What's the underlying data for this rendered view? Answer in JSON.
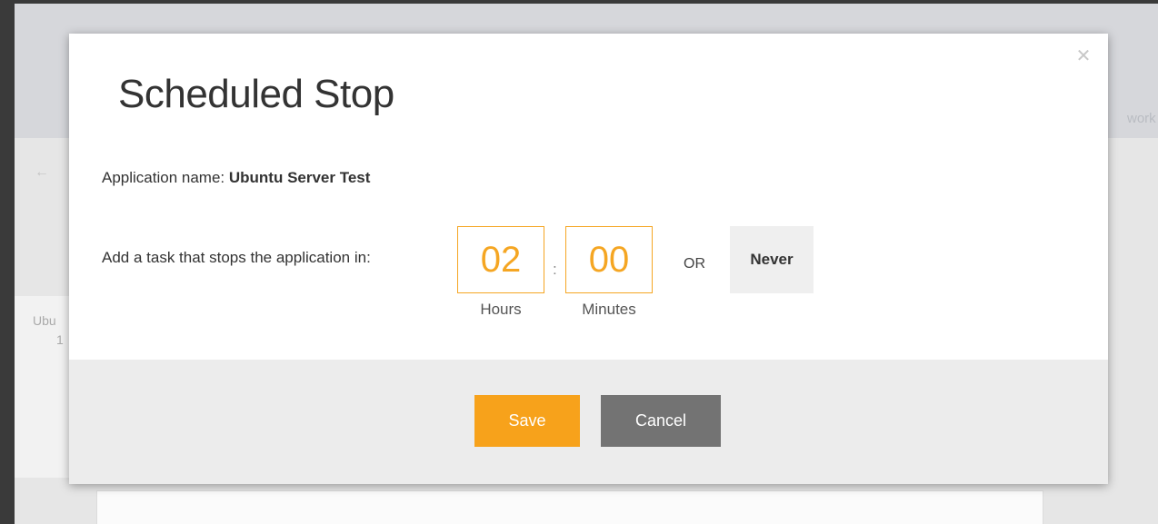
{
  "background": {
    "side_text": "work",
    "arrow": "←",
    "card_name": "Ubu",
    "card_num": "1"
  },
  "modal": {
    "title": "Scheduled Stop",
    "close_icon": "✕",
    "app_name_label": "Application name:",
    "app_name_value": "Ubuntu Server Test",
    "task_label": "Add a task that stops the application in:",
    "hours_value": "02",
    "minutes_value": "00",
    "colon": ":",
    "hours_label": "Hours",
    "minutes_label": "Minutes",
    "or_text": "OR",
    "never_label": "Never",
    "save_label": "Save",
    "cancel_label": "Cancel"
  },
  "colors": {
    "accent": "#f7a21b",
    "time_box_border": "#f5a623",
    "cancel": "#737373"
  }
}
